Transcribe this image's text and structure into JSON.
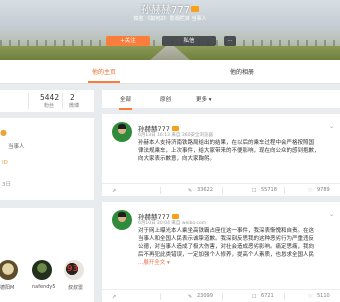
{
  "profile": {
    "name": "孙赫赫777",
    "desc": "知名 《如何2》 影视栏目 当事人",
    "follow_label": "+关注",
    "message_label": "私信",
    "more_label": "⋯"
  },
  "tabs": [
    {
      "label": "他的主页",
      "active": true
    },
    {
      "label": "他的相册",
      "active": false
    }
  ],
  "stats": [
    {
      "value": "",
      "label": ""
    },
    {
      "value": "5442",
      "label": "粉丝"
    },
    {
      "value": "2",
      "label": "微博"
    }
  ],
  "info": {
    "line1": "当事人",
    "line2": "ID",
    "line3": "3日"
  },
  "fans": [
    {
      "name": "德阳M"
    },
    {
      "name": "nafendy5"
    },
    {
      "name": "叔叔雷"
    }
  ],
  "feed_filter": {
    "all": "全部",
    "original": "原创",
    "more": "更多 ▾"
  },
  "posts": [
    {
      "author": "孙赫赫777",
      "meta": "6月13日 16:13 来自 360安全浏览器",
      "lines": [
        "孙赫本人支持济南铁路局给出的结果，在以后的乘车过程中会严格按照国",
        "律法规乘车，上次事件，给大家带来的不便影响，现在向公众的感到抱歉，",
        "向大家表示歉意，向大家鞠躬。"
      ],
      "forward": "",
      "comment": "33622",
      "like": "55718",
      "share": "9789"
    },
    {
      "author": "孙赫赫777",
      "meta": "6月10日 20:04 来自 weibo.com",
      "lines": [
        "对于网上曝光本人乘坐高铁霸占座位这一事件，我深表惭愧和自责。在这",
        "当事人和全国人民表示诚挚道歉。我深刻反思我的这种恶劣行为严重违反",
        "公德，对当事人造成了极大伤害，对社会造成恶劣影响。痛定思痛，我向",
        "后不再犯此类错误，一定加强个人修养，提高个人素质，也恳求全国人民"
      ],
      "expand": "...展开全文 ▾",
      "forward": "",
      "comment": "23099",
      "like": "6721",
      "share": "5110"
    }
  ],
  "colors": {
    "accent": "#fa7d3c",
    "vip": "#f7a11a",
    "background": "#e9ecef"
  }
}
